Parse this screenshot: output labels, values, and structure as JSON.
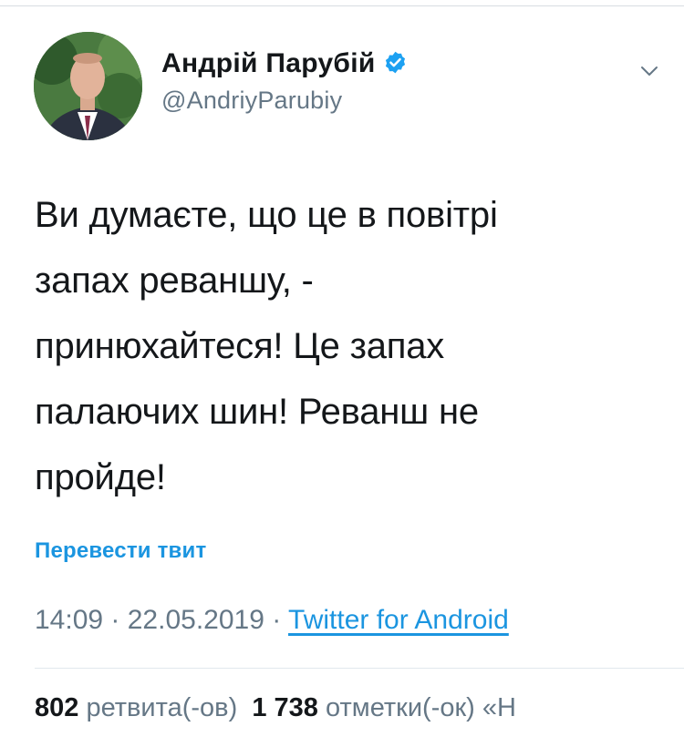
{
  "tweet": {
    "author": {
      "display_name": "Андрій Парубій",
      "handle": "@AndriyParubiy",
      "verified": true
    },
    "text": "Ви думаєте, що це в повітрі\nзапах реваншу, -\nпринюхайтеся! Це запах\nпалаючих шин! Реванш не\nпройде!",
    "translate_label": "Перевести твит",
    "time": "14:09",
    "separator": " · ",
    "date": "22.05.2019",
    "source": "Twitter for Android",
    "stats": {
      "retweets_count": "802",
      "retweets_label": "ретвита(-ов)",
      "likes_count": "1 738",
      "likes_label": "отметки(-ок) «Н"
    }
  },
  "colors": {
    "link": "#1b95e0",
    "secondary_text": "#657786",
    "primary_text": "#14171a"
  },
  "icons": {
    "verified": "verified-badge-icon",
    "menu": "chevron-down-icon"
  }
}
